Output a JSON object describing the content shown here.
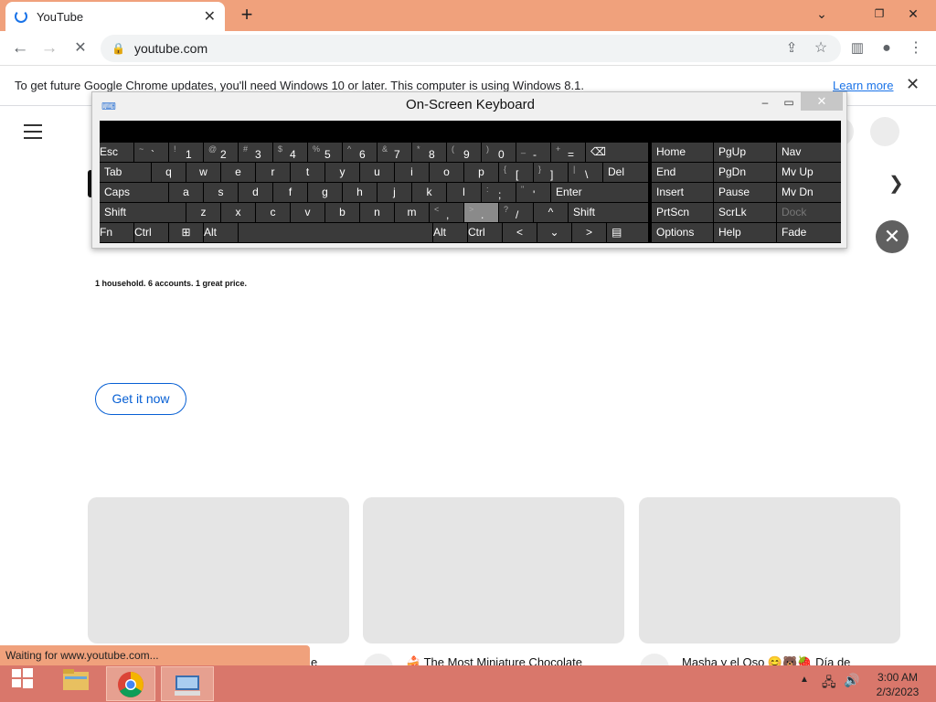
{
  "browser": {
    "tab_title": "YouTube",
    "tab_close": "✕",
    "new_tab": "+",
    "url": "youtube.com",
    "window_buttons": [
      "⌄",
      "❐",
      "✕"
    ]
  },
  "infobar": {
    "message": "To get future Google Chrome updates, you'll need Windows 10 or later. This computer is using Windows 8.1.",
    "learn_more": "Learn more",
    "close": "✕"
  },
  "page": {
    "tagline": "1 household. 6 accounts. 1 great price.",
    "cta": "Get it now",
    "cards": [
      {
        "title": "e"
      },
      {
        "title": "🍰 The Most Miniature Chocolate"
      },
      {
        "title": "Masha y el Oso 😊🐻🍓 Día de"
      }
    ]
  },
  "status_text": "Waiting for www.youtube.com...",
  "osk": {
    "title": "On-Screen Keyboard",
    "rows": [
      [
        {
          "m": "Esc"
        },
        {
          "s": "~",
          "m": "`"
        },
        {
          "s": "!",
          "m": "1"
        },
        {
          "s": "@",
          "m": "2"
        },
        {
          "s": "#",
          "m": "3"
        },
        {
          "s": "$",
          "m": "4"
        },
        {
          "s": "%",
          "m": "5"
        },
        {
          "s": "^",
          "m": "6"
        },
        {
          "s": "&",
          "m": "7"
        },
        {
          "s": "*",
          "m": "8"
        },
        {
          "s": "(",
          "m": "9"
        },
        {
          "s": ")",
          "m": "0"
        },
        {
          "s": "_",
          "m": "-"
        },
        {
          "s": "+",
          "m": "="
        },
        {
          "m": "⌫"
        }
      ],
      [
        {
          "m": "Tab"
        },
        {
          "m": "q"
        },
        {
          "m": "w"
        },
        {
          "m": "e"
        },
        {
          "m": "r"
        },
        {
          "m": "t"
        },
        {
          "m": "y"
        },
        {
          "m": "u"
        },
        {
          "m": "i"
        },
        {
          "m": "o"
        },
        {
          "m": "p"
        },
        {
          "s": "{",
          "m": "["
        },
        {
          "s": "}",
          "m": "]"
        },
        {
          "s": "|",
          "m": "\\"
        },
        {
          "m": "Del"
        }
      ],
      [
        {
          "m": "Caps"
        },
        {
          "m": "a"
        },
        {
          "m": "s"
        },
        {
          "m": "d"
        },
        {
          "m": "f"
        },
        {
          "m": "g"
        },
        {
          "m": "h"
        },
        {
          "m": "j"
        },
        {
          "m": "k"
        },
        {
          "m": "l"
        },
        {
          "s": ":",
          "m": ";"
        },
        {
          "s": "\"",
          "m": "'"
        },
        {
          "m": "Enter"
        }
      ],
      [
        {
          "m": "Shift"
        },
        {
          "m": "z"
        },
        {
          "m": "x"
        },
        {
          "m": "c"
        },
        {
          "m": "v"
        },
        {
          "m": "b"
        },
        {
          "m": "n"
        },
        {
          "m": "m"
        },
        {
          "s": "<",
          "m": ","
        },
        {
          "s": ">",
          "m": "."
        },
        {
          "s": "?",
          "m": "/"
        },
        {
          "m": "^"
        },
        {
          "m": "Shift"
        }
      ],
      [
        {
          "m": "Fn"
        },
        {
          "m": "Ctrl"
        },
        {
          "m": "⊞"
        },
        {
          "m": "Alt"
        },
        {
          "m": ""
        },
        {
          "m": "Alt"
        },
        {
          "m": "Ctrl"
        },
        {
          "m": "<"
        },
        {
          "m": "⌄"
        },
        {
          "m": ">"
        },
        {
          "m": "▤"
        }
      ]
    ],
    "right": [
      [
        "Home",
        "PgUp",
        "Nav"
      ],
      [
        "End",
        "PgDn",
        "Mv Up"
      ],
      [
        "Insert",
        "Pause",
        "Mv Dn"
      ],
      [
        "PrtScn",
        "ScrLk",
        "Dock"
      ],
      [
        "Options",
        "Help",
        "Fade"
      ]
    ]
  },
  "clock": {
    "time": "3:00 AM",
    "date": "2/3/2023"
  }
}
